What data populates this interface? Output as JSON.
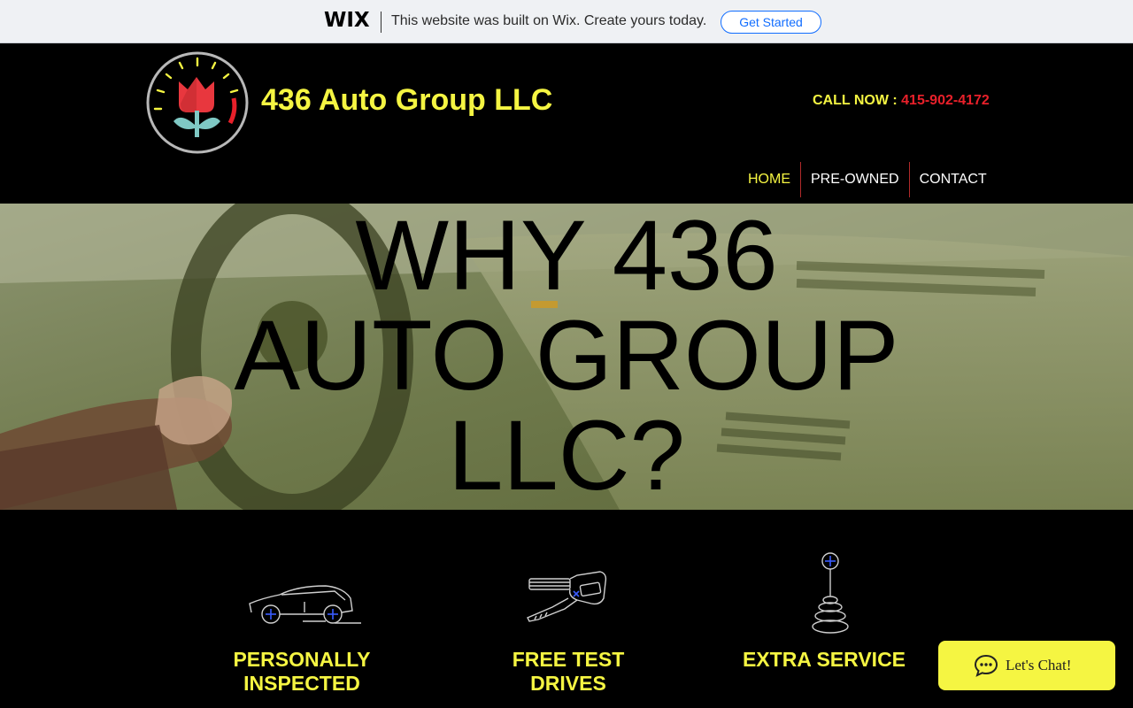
{
  "wix_banner": {
    "logo": "WIX",
    "message": "This website was built on Wix. Create yours today.",
    "cta": "Get Started"
  },
  "header": {
    "site_title": "436 Auto Group LLC",
    "call_label": "CALL NOW : ",
    "phone": "415-902-4172",
    "logo_icon": "tulip-speedometer-logo"
  },
  "nav": {
    "items": [
      {
        "label": "HOME",
        "active": true
      },
      {
        "label": "PRE-OWNED",
        "active": false
      },
      {
        "label": "CONTACT",
        "active": false
      }
    ]
  },
  "hero": {
    "line1": "WHY 436",
    "line2": "AUTO GROUP",
    "line3": "LLC?"
  },
  "features": [
    {
      "icon": "car-icon",
      "label_line1": "PERSONALLY",
      "label_line2": "INSPECTED"
    },
    {
      "icon": "car-key-icon",
      "label_line1": "FREE TEST",
      "label_line2": "DRIVES"
    },
    {
      "icon": "gear-shift-icon",
      "label_line1": "EXTRA SERVICE",
      "label_line2": ""
    }
  ],
  "chat": {
    "label": "Let's Chat!",
    "icon": "chat-bubble-icon"
  },
  "colors": {
    "accent_yellow": "#f5f542",
    "phone_red": "#e8202a",
    "wix_blue": "#116dff"
  }
}
